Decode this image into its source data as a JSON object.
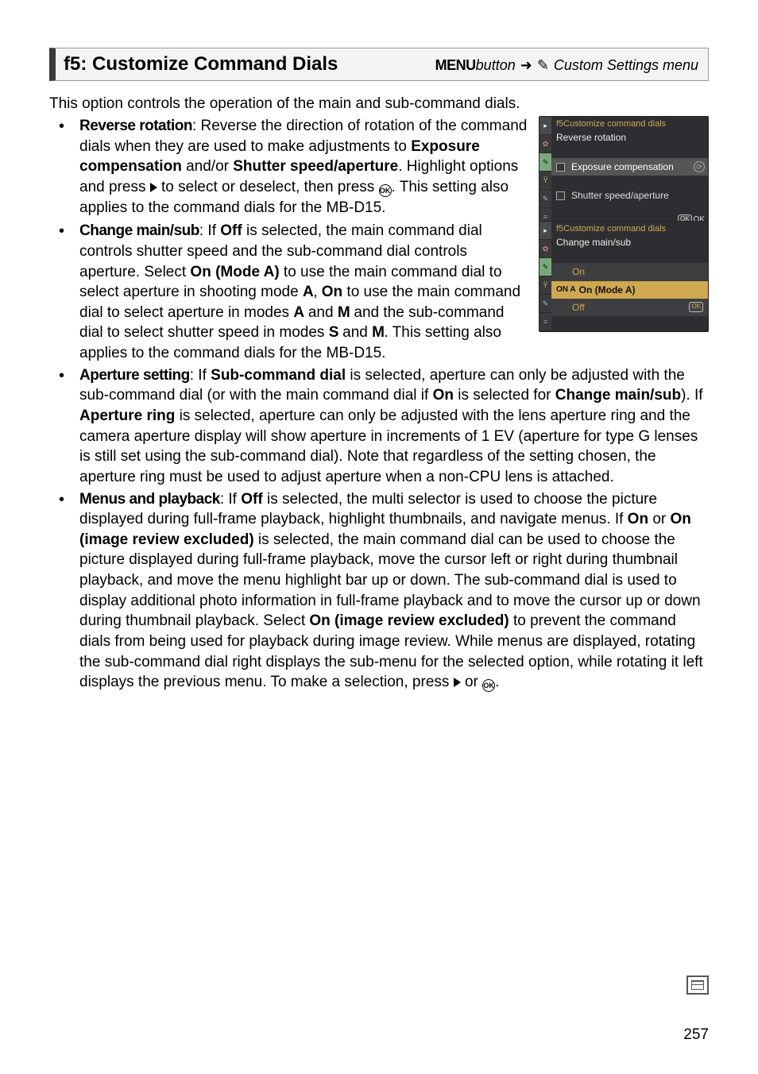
{
  "heading": {
    "title": "f5: Customize Command Dials",
    "menu_label": "MENU",
    "button_word": " button ",
    "arrow": "➜",
    "menu_suffix": " Custom Settings menu"
  },
  "intro": "This option controls the operation of the main and sub-command dials.",
  "bullets": {
    "reverse": {
      "label": "Reverse rotation",
      "seg1": ": Reverse the direction of rotation of the command dials when they are used to make adjustments to ",
      "exp_comp": "Exposure compensation",
      "andor": " and/or ",
      "shutter_ap": "Shutter speed/aperture",
      "seg2": ". Highlight options and press ",
      "seg3": " to select or deselect, then press ",
      "seg4": ". This setting also applies to the command dials for the MB-D15."
    },
    "change": {
      "label": "Change main/sub",
      "seg1": ": If ",
      "off": "Off",
      "seg2": " is selected, the main command dial controls shutter speed and the sub-command dial controls aperture. Select ",
      "on_modea": "On (Mode A)",
      "seg3": " to use the main command dial to select aperture in shooting mode ",
      "modeA": "A",
      "seg4": ", ",
      "on": "On",
      "seg5": " to use the main command dial to select aperture in modes ",
      "modeA2": "A",
      "seg6": " and ",
      "modeM": "M",
      "seg7": " and the sub-command dial to select shutter speed in modes ",
      "modeS": "S",
      "seg8": " and ",
      "modeM2": "M",
      "seg9": ". This setting also applies to the command dials for the MB-D15."
    },
    "aperture": {
      "label": "Aperture setting",
      "seg1": ": If ",
      "subcmd": "Sub-command dial",
      "seg2": " is selected, aperture can only be adjusted with the sub-command dial (or with the main command dial if ",
      "on": "On",
      "seg3": " is selected for ",
      "cms": "Change main/sub",
      "seg4": "). If ",
      "apring": "Aperture ring",
      "seg5": " is selected, aperture can only be adjusted with the lens aperture ring and the camera aperture display will show aperture in increments of 1 EV (aperture for type G lenses is still set using the sub-command dial). Note that regardless of the setting chosen, the aperture ring must be used to adjust aperture when a non-CPU lens is attached."
    },
    "menus": {
      "label": "Menus and playback",
      "seg1": ": If ",
      "off": "Off",
      "seg2": " is selected, the multi selector is used to choose the picture displayed during full-frame playback, highlight thumbnails, and navigate menus. If ",
      "on": "On",
      "seg3": " or ",
      "on_irex": "On (image review excluded)",
      "seg4": " is selected, the main command dial can be used to choose the picture displayed during full-frame playback, move the cursor left or right during thumbnail playback, and move the menu highlight bar up or down. The sub-command dial is used to display additional photo information in full-frame playback and to move the cursor up or down during thumbnail playback. Select ",
      "on_irex2": "On (image review excluded)",
      "seg5": " to prevent the command dials from being used for playback during image review. While menus are displayed, rotating the sub-command dial right displays the sub-menu for the selected option, while rotating it left displays the previous menu. To make a selection, press ",
      "seg6": " or "
    }
  },
  "screen1": {
    "topline": "f5Customize command dials",
    "subtitle": "Reverse rotation",
    "row1": "Exposure compensation",
    "row2": "Shutter speed/aperture",
    "ok": "OK"
  },
  "screen2": {
    "topline": "f5Customize command dials",
    "subtitle": "Change main/sub",
    "opt_on": "On",
    "opt_on_modea_pre": "ON A",
    "opt_on_modea": "On (Mode A)",
    "opt_off": "Off",
    "ok": "OK"
  },
  "page_num": "257",
  "ok_glyph": "OK"
}
